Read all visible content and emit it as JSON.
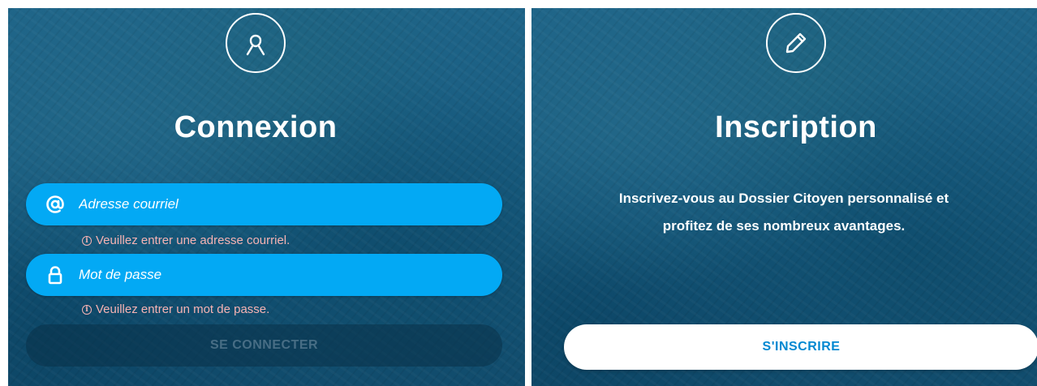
{
  "login": {
    "title": "Connexion",
    "email": {
      "placeholder": "Adresse courriel",
      "value": "",
      "error": "Veuillez entrer une adresse courriel."
    },
    "password": {
      "placeholder": "Mot de passe",
      "value": "",
      "error": "Veuillez entrer un mot de passe."
    },
    "submit_label": "SE CONNECTER",
    "icons": {
      "header": "user-icon",
      "email": "at-sign-icon",
      "password": "lock-icon",
      "error": "info-icon"
    }
  },
  "signup": {
    "title": "Inscription",
    "description": "Inscrivez-vous au Dossier Citoyen personnalisé et profitez de ses nombreux avantages.",
    "button_label": "S'INSCRIRE",
    "icons": {
      "header": "pencil-icon"
    }
  },
  "colors": {
    "field_background": "#03a9f4",
    "panel_background": "#175a7e",
    "error_text": "#f6b3b3",
    "signup_text": "#0288d1"
  }
}
